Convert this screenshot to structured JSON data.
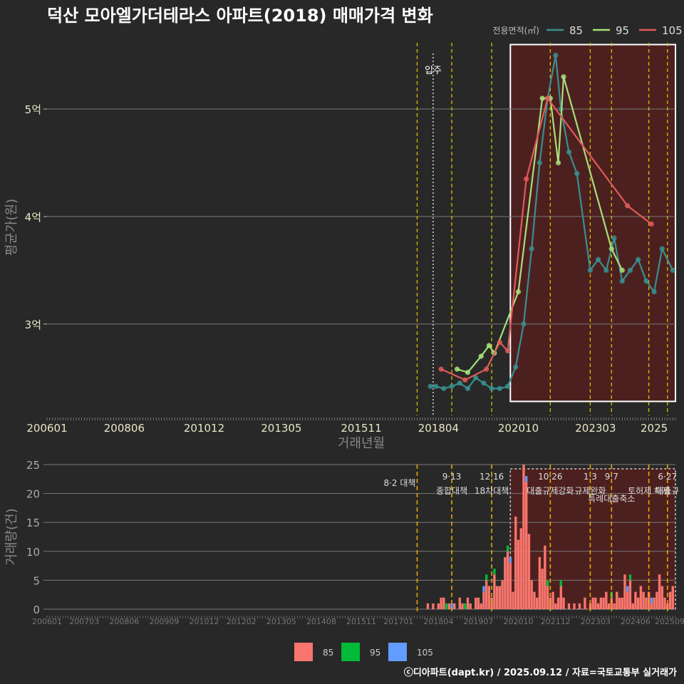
{
  "title": "덕산 모아엘가더테라스 아파트(2018) 매매가격 변화",
  "footer": "ⓒ디아파트(dapt.kr) / 2025.09.12 / 자료=국토교통부 실거래가",
  "colors": {
    "s85": "#3a8f8f",
    "s95": "#a6e07a",
    "s105": "#e05a5a",
    "b85": "#f8766d",
    "b95": "#00ba38",
    "b105": "#619cff",
    "policy": "#d4c000",
    "policy_bottom": "#e6a800",
    "shade": "#5a1e1e"
  },
  "chart_data": [
    {
      "type": "line",
      "title": "덕산 모아엘가더테라스 아파트(2018) 매매가격 변화",
      "xlabel": "거래년월",
      "ylabel": "평균가(원)",
      "x_tick_labels": [
        "200601",
        "200806",
        "201012",
        "201305",
        "201511",
        "201804",
        "202010",
        "202303",
        "2025"
      ],
      "y_tick_labels": [
        "3억",
        "4억",
        "5억"
      ],
      "y_ticks": [
        3,
        4,
        5
      ],
      "ylim": [
        2.15,
        5.65
      ],
      "xlim": [
        "2006-01",
        "2025-09"
      ],
      "legend_title": "전용면적(㎡)",
      "legend_position": "top-right",
      "move_in_label": "입주",
      "move_in_date": "2018-02",
      "policy_dates": [
        "2017-08",
        "2018-09",
        "2019-12",
        "2021-10",
        "2023-01",
        "2023-09",
        "2024-11",
        "2025-06"
      ],
      "highlight_range": [
        "2020-07",
        "2025-09"
      ],
      "highlight_price_range": [
        2.28,
        5.6
      ],
      "series": [
        {
          "name": "85",
          "points": [
            [
              "2018-01",
              2.42
            ],
            [
              "2018-03",
              2.42
            ],
            [
              "2018-06",
              2.4
            ],
            [
              "2018-09",
              2.42
            ],
            [
              "2018-12",
              2.45
            ],
            [
              "2019-03",
              2.4
            ],
            [
              "2019-06",
              2.5
            ],
            [
              "2019-09",
              2.45
            ],
            [
              "2019-12",
              2.4
            ],
            [
              "2020-03",
              2.4
            ],
            [
              "2020-06",
              2.42
            ],
            [
              "2020-09",
              2.6
            ],
            [
              "2020-12",
              3.0
            ],
            [
              "2021-03",
              3.7
            ],
            [
              "2021-06",
              4.5
            ],
            [
              "2021-09",
              5.1
            ],
            [
              "2021-12",
              5.5
            ],
            [
              "2022-02",
              5.0
            ],
            [
              "2022-05",
              4.6
            ],
            [
              "2022-08",
              4.4
            ],
            [
              "2023-01",
              3.5
            ],
            [
              "2023-04",
              3.6
            ],
            [
              "2023-07",
              3.5
            ],
            [
              "2023-10",
              3.8
            ],
            [
              "2024-01",
              3.4
            ],
            [
              "2024-04",
              3.5
            ],
            [
              "2024-07",
              3.6
            ],
            [
              "2024-10",
              3.4
            ],
            [
              "2025-01",
              3.3
            ],
            [
              "2025-04",
              3.7
            ],
            [
              "2025-08",
              3.5
            ]
          ]
        },
        {
          "name": "95",
          "points": [
            [
              "2018-11",
              2.58
            ],
            [
              "2019-03",
              2.55
            ],
            [
              "2019-08",
              2.7
            ],
            [
              "2019-11",
              2.8
            ],
            [
              "2020-01",
              2.73
            ],
            [
              "2020-10",
              3.3
            ],
            [
              "2021-07",
              5.1
            ],
            [
              "2021-10",
              5.1
            ],
            [
              "2022-01",
              4.5
            ],
            [
              "2022-03",
              5.3
            ],
            [
              "2023-09",
              3.7
            ],
            [
              "2024-01",
              3.5
            ]
          ]
        },
        {
          "name": "105",
          "points": [
            [
              "2018-05",
              2.58
            ],
            [
              "2019-02",
              2.48
            ],
            [
              "2019-10",
              2.58
            ],
            [
              "2020-03",
              2.83
            ],
            [
              "2020-06",
              2.75
            ],
            [
              "2021-01",
              4.35
            ],
            [
              "2021-09",
              5.1
            ],
            [
              "2024-03",
              4.1
            ],
            [
              "2024-12",
              3.93
            ]
          ]
        }
      ]
    },
    {
      "type": "bar",
      "xlabel": "",
      "ylabel": "거래량(건)",
      "ylim": [
        0,
        25
      ],
      "y_ticks": [
        0,
        5,
        10,
        15,
        20,
        25
      ],
      "x_tick_labels": [
        "200601",
        "200703",
        "200806",
        "200909",
        "201012",
        "201202",
        "201305",
        "201408",
        "201511",
        "201701",
        "201804",
        "201907",
        "202010",
        "202112",
        "202303",
        "202406",
        "202509"
      ],
      "legend_position": "bottom",
      "highlight_range": [
        "2020-07",
        "2025-09"
      ],
      "policy_annotations": [
        {
          "date": "2017-08",
          "line1": "8·2 대책",
          "line2": ""
        },
        {
          "date": "2018-09",
          "line1": "9·13",
          "line2": "종합대책"
        },
        {
          "date": "2019-12",
          "line1": "12·16",
          "line2": "18차대책"
        },
        {
          "date": "2021-10",
          "line1": "10·26",
          "line2": "대출규제강화"
        },
        {
          "date": "2023-01",
          "line1": "1·3",
          "line2": "규제완화"
        },
        {
          "date": "2023-09",
          "line1": "9·7",
          "line2": "특례대출축소"
        },
        {
          "date": "2024-11",
          "line1": "",
          "line2": "토허제 해제"
        },
        {
          "date": "2025-06",
          "line1": "6·27",
          "line2": "대출규"
        }
      ],
      "series": [
        {
          "name": "85",
          "points": [
            [
              "2017-12",
              1
            ],
            [
              "2018-02",
              1
            ],
            [
              "2018-04",
              1
            ],
            [
              "2018-05",
              2
            ],
            [
              "2018-06",
              2
            ],
            [
              "2018-08",
              1
            ],
            [
              "2018-10",
              1
            ],
            [
              "2018-12",
              2
            ],
            [
              "2019-01",
              1
            ],
            [
              "2019-03",
              2
            ],
            [
              "2019-04",
              1
            ],
            [
              "2019-06",
              2
            ],
            [
              "2019-07",
              2
            ],
            [
              "2019-08",
              1
            ],
            [
              "2019-09",
              3
            ],
            [
              "2019-10",
              5
            ],
            [
              "2019-11",
              4
            ],
            [
              "2019-12",
              2
            ],
            [
              "2020-01",
              6
            ],
            [
              "2020-02",
              4
            ],
            [
              "2020-03",
              4
            ],
            [
              "2020-04",
              5
            ],
            [
              "2020-05",
              9
            ],
            [
              "2020-06",
              10
            ],
            [
              "2020-07",
              8
            ],
            [
              "2020-08",
              3
            ],
            [
              "2020-09",
              16
            ],
            [
              "2020-10",
              12
            ],
            [
              "2020-11",
              14
            ],
            [
              "2020-12",
              25
            ],
            [
              "2021-01",
              22
            ],
            [
              "2021-02",
              13
            ],
            [
              "2021-03",
              5
            ],
            [
              "2021-04",
              3
            ],
            [
              "2021-05",
              2
            ],
            [
              "2021-06",
              9
            ],
            [
              "2021-07",
              7
            ],
            [
              "2021-08",
              11
            ],
            [
              "2021-09",
              4
            ],
            [
              "2021-10",
              2
            ],
            [
              "2021-11",
              3
            ],
            [
              "2021-12",
              1
            ],
            [
              "2022-01",
              2
            ],
            [
              "2022-02",
              4
            ],
            [
              "2022-03",
              2
            ],
            [
              "2022-05",
              1
            ],
            [
              "2022-07",
              1
            ],
            [
              "2022-09",
              1
            ],
            [
              "2022-11",
              2
            ],
            [
              "2023-01",
              1
            ],
            [
              "2023-02",
              2
            ],
            [
              "2023-03",
              2
            ],
            [
              "2023-04",
              1
            ],
            [
              "2023-05",
              2
            ],
            [
              "2023-06",
              2
            ],
            [
              "2023-07",
              3
            ],
            [
              "2023-08",
              1
            ],
            [
              "2023-09",
              2
            ],
            [
              "2023-10",
              1
            ],
            [
              "2023-11",
              3
            ],
            [
              "2023-12",
              2
            ],
            [
              "2024-01",
              2
            ],
            [
              "2024-02",
              6
            ],
            [
              "2024-03",
              3
            ],
            [
              "2024-04",
              5
            ],
            [
              "2024-05",
              1
            ],
            [
              "2024-06",
              3
            ],
            [
              "2024-07",
              2
            ],
            [
              "2024-08",
              4
            ],
            [
              "2024-09",
              3
            ],
            [
              "2024-10",
              2
            ],
            [
              "2024-11",
              3
            ],
            [
              "2024-12",
              1
            ],
            [
              "2025-01",
              2
            ],
            [
              "2025-02",
              3
            ],
            [
              "2025-03",
              6
            ],
            [
              "2025-04",
              4
            ],
            [
              "2025-05",
              2
            ],
            [
              "2025-06",
              1
            ],
            [
              "2025-07",
              3
            ],
            [
              "2025-08",
              4
            ]
          ]
        },
        {
          "name": "95",
          "points": [
            [
              "2018-07",
              1
            ],
            [
              "2019-02",
              1
            ],
            [
              "2019-10",
              1
            ],
            [
              "2020-01",
              1
            ],
            [
              "2020-06",
              1
            ],
            [
              "2021-09",
              1
            ],
            [
              "2022-02",
              1
            ],
            [
              "2023-09",
              1
            ],
            [
              "2024-04",
              1
            ]
          ]
        },
        {
          "name": "105",
          "points": [
            [
              "2018-09",
              1
            ],
            [
              "2019-09",
              1
            ],
            [
              "2020-07",
              1
            ],
            [
              "2021-01",
              1
            ],
            [
              "2024-03",
              1
            ],
            [
              "2024-12",
              1
            ]
          ]
        }
      ]
    }
  ]
}
